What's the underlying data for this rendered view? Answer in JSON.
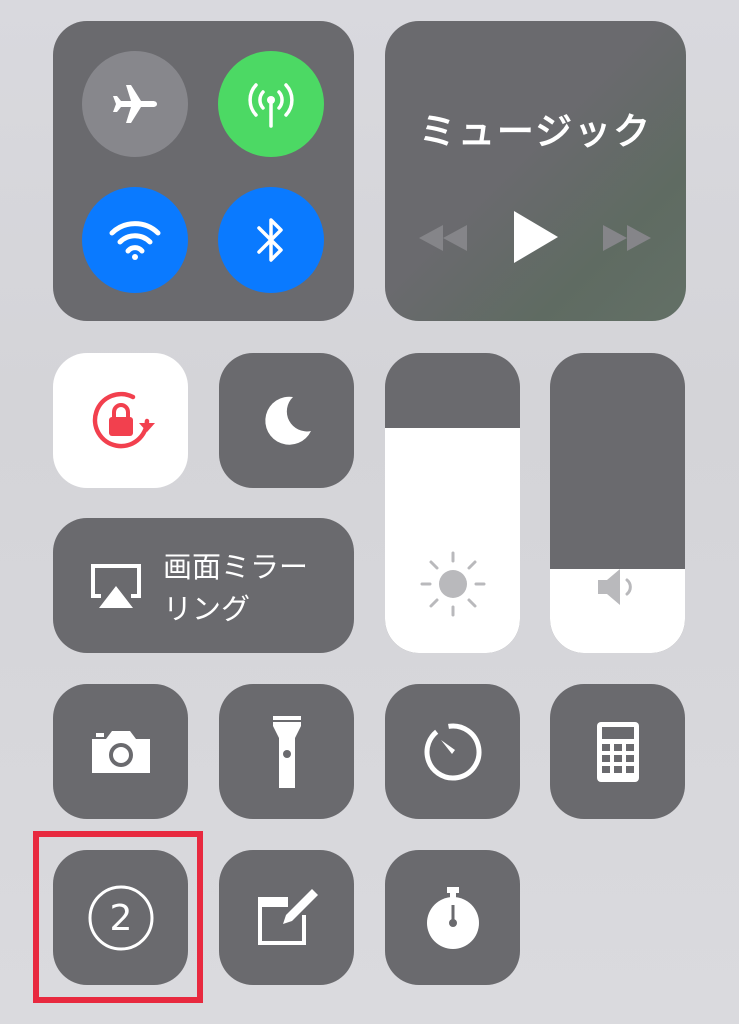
{
  "connectivity": {
    "airplane_mode": {
      "icon": "airplane-icon",
      "state": "off",
      "color": "#87878c"
    },
    "cellular_data": {
      "icon": "antenna-icon",
      "state": "on",
      "color": "#4cd964"
    },
    "wifi": {
      "icon": "wifi-icon",
      "state": "on",
      "color": "#0a7aff"
    },
    "bluetooth": {
      "icon": "bluetooth-icon",
      "state": "on",
      "color": "#0a7aff"
    }
  },
  "music": {
    "title": "ミュージック",
    "controls": [
      "rewind-icon",
      "play-icon",
      "fast-forward-icon"
    ]
  },
  "orientation_lock": {
    "icon": "rotation-lock-icon",
    "state": "on",
    "color": "#f2404e"
  },
  "do_not_disturb": {
    "icon": "moon-icon",
    "state": "off"
  },
  "brightness": {
    "icon": "sun-icon",
    "level": 0.75
  },
  "volume": {
    "icon": "speaker-icon",
    "level": 0.28
  },
  "screen_mirroring": {
    "label": "画面ミラー\nリング",
    "icon": "airplay-icon"
  },
  "shortcuts_row1": [
    "camera-icon",
    "flashlight-icon",
    "timer-icon",
    "calculator-icon"
  ],
  "shortcuts_row2": {
    "badge_button": {
      "icon": "circled-number-icon",
      "label": "2"
    },
    "notes": "notes-icon",
    "stopwatch": "stopwatch-icon"
  },
  "highlight_color": "#e8293f"
}
